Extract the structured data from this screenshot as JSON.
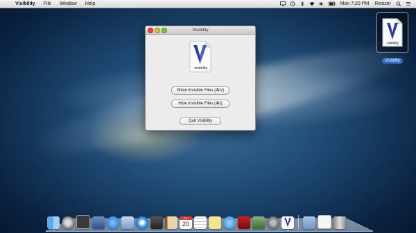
{
  "menubar": {
    "app_name": "Visibility",
    "items": [
      "File",
      "Window",
      "Help"
    ],
    "clock": "Mon 7:20 PM",
    "extra_app": "Resizer"
  },
  "desktop_icon": {
    "label": "Visibility",
    "art_text": ".visibility"
  },
  "window": {
    "title": "Visibility",
    "logo_text": ".visibility",
    "buttons": {
      "show": "Show Invisible Files (⌘V)",
      "hide": "Hide Invisible Files (⌘I)",
      "quit": "Quit Visibility"
    }
  },
  "dock": {
    "calendar_day": "20",
    "calendar_month": "JUL",
    "items": [
      "finder",
      "launchpad",
      "dashboard",
      "mission-control",
      "app-store",
      "mail",
      "safari",
      "facetime",
      "contacts",
      "calendar",
      "reminders",
      "notes",
      "itunes",
      "photo-booth",
      "iphoto",
      "system-preferences",
      "visibility",
      "downloads",
      "documents",
      "trash"
    ]
  }
}
